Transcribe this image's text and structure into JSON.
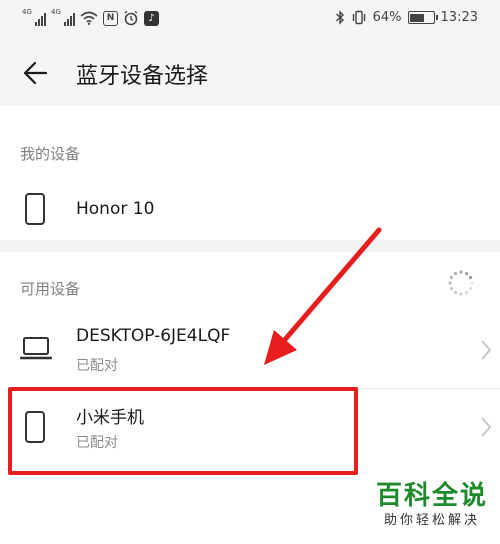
{
  "status_bar": {
    "network1": "4G",
    "network2": "4G",
    "nfc_glyph": "N",
    "battery": "64%",
    "time": "13:23",
    "icons": [
      "signal-icon",
      "signal-icon",
      "wifi-icon",
      "nfc-icon",
      "alarm-icon",
      "tiktok-icon",
      "bluetooth-icon",
      "vibrate-icon",
      "battery-icon"
    ]
  },
  "header": {
    "title": "蓝牙设备选择",
    "back_icon": "arrow-left-icon"
  },
  "my_devices": {
    "label": "我的设备",
    "items": [
      {
        "name": "Honor 10",
        "icon": "phone-icon"
      }
    ]
  },
  "available_devices": {
    "label": "可用设备",
    "scanning_icon": "loading-spinner-icon",
    "items": [
      {
        "name": "DESKTOP-6JE4LQF",
        "status": "已配对",
        "icon": "laptop-icon"
      },
      {
        "name": "小米手机",
        "status": "已配对",
        "icon": "phone-icon"
      }
    ]
  },
  "annotation": {
    "color": "#e81e1e"
  },
  "watermark": {
    "title": "百科全说",
    "subtitle": "助你轻松解决"
  }
}
